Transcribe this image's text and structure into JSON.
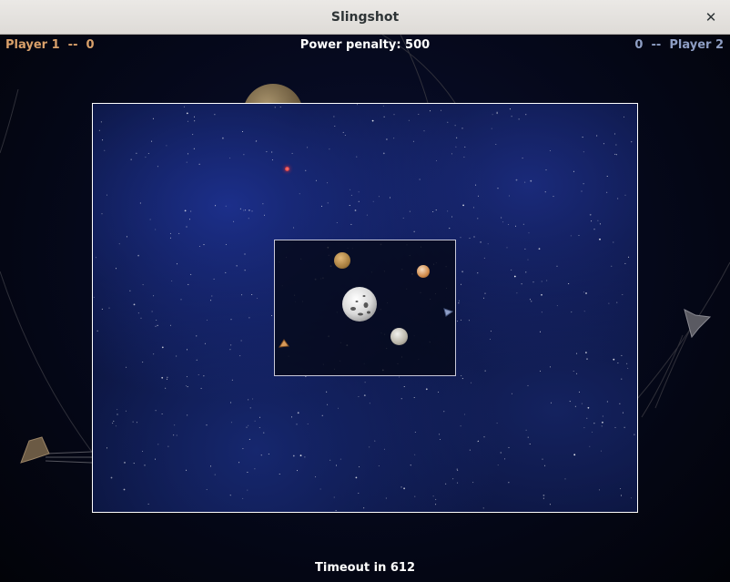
{
  "window": {
    "title": "Slingshot",
    "close_glyph": "✕"
  },
  "hud": {
    "player1": "Player 1  --  0",
    "player2": "0  --  Player 2",
    "power_penalty": "Power penalty: 500",
    "timeout": "Timeout in 612"
  },
  "colors": {
    "player1": "#d9a06a",
    "player2": "#8e9ec4",
    "frame": "#ffffff"
  },
  "objects": {
    "planets": [
      "tan-planet",
      "orange-planet",
      "white-planet",
      "grey-planet",
      "distant-planet"
    ],
    "ships": [
      "player1-ship",
      "player2-ship"
    ],
    "missile": "red-missile"
  }
}
